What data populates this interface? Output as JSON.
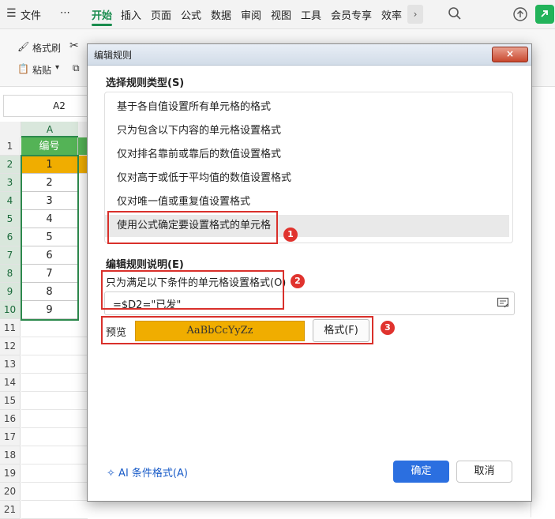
{
  "menu": {
    "file": "文件",
    "more": "⋯",
    "tabs": [
      "开始",
      "插入",
      "页面",
      "公式",
      "数据",
      "审阅",
      "视图",
      "工具",
      "会员专享",
      "效率"
    ],
    "active_tab": "开始"
  },
  "ribbon": {
    "format_painter": "格式刷",
    "paste": "粘贴"
  },
  "name_box": "A2",
  "sheet": {
    "column_a": "A",
    "row_numbers": [
      "1",
      "2",
      "3",
      "4",
      "5",
      "6",
      "7",
      "8",
      "9",
      "10",
      "11",
      "12",
      "13",
      "14",
      "15",
      "16",
      "17",
      "18",
      "19",
      "20",
      "21"
    ],
    "header_cell": "编号",
    "values": [
      "1",
      "2",
      "3",
      "4",
      "5",
      "6",
      "7",
      "8",
      "9"
    ]
  },
  "dialog": {
    "title": "编辑规则",
    "close_label": "×",
    "rule_type_label": "选择规则类型(S)",
    "rule_types": [
      "基于各自值设置所有单元格的格式",
      "只为包含以下内容的单元格设置格式",
      "仅对排名靠前或靠后的数值设置格式",
      "仅对高于或低于平均值的数值设置格式",
      "仅对唯一值或重复值设置格式",
      "使用公式确定要设置格式的单元格"
    ],
    "selected_rule_index": 5,
    "edit_desc_label": "编辑规则说明(E)",
    "condition_label": "只为满足以下条件的单元格设置格式(O)",
    "formula": "=$D2=\"已发\"",
    "preview_label": "预览",
    "preview_text": "AaBbCcYyZz",
    "format_button": "格式(F)",
    "ai_link": "AI 条件格式(A)",
    "ok": "确定",
    "cancel": "取消"
  },
  "callouts": [
    "1",
    "2",
    "3"
  ],
  "colors": {
    "accent_green": "#1a8c4e",
    "header_fill": "#54b356",
    "highlight_fill": "#f0ad00",
    "primary_button": "#2b6fe0",
    "callout_red": "#d9302b"
  }
}
